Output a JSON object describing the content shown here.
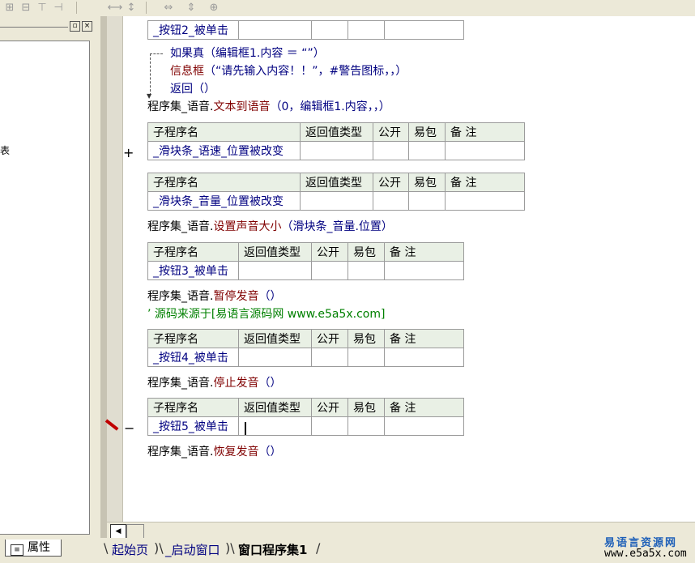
{
  "toolbar": {
    "icons": [
      "align-left-icon",
      "align-center-icon",
      "align-top-icon",
      "align-right-icon",
      "equal-width-icon",
      "equal-height-icon",
      "stretch-horizontal-icon",
      "stretch-vertical-icon",
      "center-window-icon"
    ]
  },
  "left_panel": {
    "fragment": "表",
    "tab_label": "属性"
  },
  "header": {
    "name": "子程序名",
    "return_type": "返回值类型",
    "public": "公开",
    "easy": "易包",
    "notes": "备 注"
  },
  "code": {
    "btn2": "_按钮2_被单击",
    "if_kw": "如果真",
    "if_cond": "（编辑框1.内容 ＝ “”）",
    "msg_fn": "信息框",
    "msg_args": "（“请先输入内容！！”，#警告图标，，）",
    "ret_fn": "返回",
    "ret_args": "（）",
    "stmt1_obj": "程序集_语音.",
    "stmt1_fn": "文本到语音",
    "stmt1_args": "（0，编辑框1.内容，，）",
    "slider_speed": "_滑块条_语速_位置被改变",
    "slider_volume": "_滑块条_音量_位置被改变",
    "stmt2_obj": "程序集_语音.",
    "stmt2_fn": "设置声音大小",
    "stmt2_args": "（滑块条_音量.位置）",
    "btn3": "_按钮3_被单击",
    "stmt3_obj": "程序集_语音.",
    "stmt3_fn": "暂停发音",
    "stmt3_args": "（）",
    "comment": "’ 源码来源于[易语言源码网 www.e5a5x.com]",
    "btn4": "_按钮4_被单击",
    "stmt4_obj": "程序集_语音.",
    "stmt4_fn": "停止发音",
    "stmt4_args": "（）",
    "btn5": "_按钮5_被单击",
    "stmt5_obj": "程序集_语音.",
    "stmt5_fn": "恢复发音",
    "stmt5_args": "（）",
    "expand_marker": "+",
    "collapse_marker": "−"
  },
  "tabs": {
    "start": "起始页",
    "startup": "_启动窗口",
    "active": "窗口程序集1"
  },
  "watermark": {
    "name": "易语言资源网",
    "url": "www.e5a5x.com"
  }
}
